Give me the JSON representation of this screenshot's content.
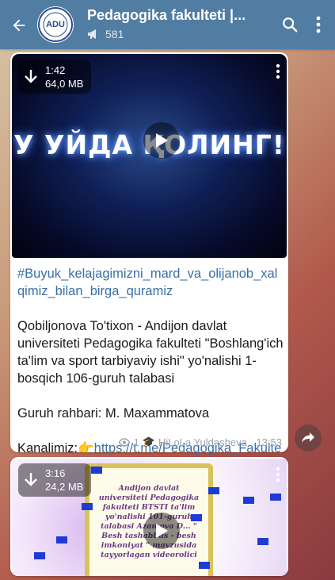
{
  "header": {
    "title": "Pedagogika fakulteti |...",
    "subscribers": "581",
    "avatar_text": "ADU"
  },
  "message1": {
    "video": {
      "duration": "1:42",
      "size": "64,0 MB",
      "overlay_text": "У УЙДА ҚОЛИНГ!"
    },
    "hashtag": "#Buyuk_kelajagimizni_mard_va_olijanob_xalqimiz_bilan_birga_quramiz",
    "body": "Qobiljonova To'tixon -  Andijon davlat universiteti Pedagogika fakulteti \"Boshlang'ich ta'lim va sport tarbiyaviy ishi\" yo'nalishi 1-bosqich 106-guruh talabasi",
    "leader": "Guruh rahbari: M. Maxammatova",
    "channel_label": "Kanalimiz:",
    "channel_link": "https://t.me/Pedagogika_Fakulteti",
    "views": "1",
    "author": "HiLoLa Yuldasheva",
    "time": "13:53"
  },
  "message2": {
    "video": {
      "duration": "3:16",
      "size": "24,2 MB",
      "frame_text": "Andijon davlat universiteti Pedagogika fakulteti BTSTI ta'lim yo'nalishi 101-guruh talabasi Azamova D... \" Besh tashabbus - besh imkoniyat \" mavzusida tayyorlagan videorolici"
    }
  },
  "colors": {
    "header_bg": "#527da3",
    "link": "#3a6fa8",
    "meta": "#9aa3ab"
  }
}
